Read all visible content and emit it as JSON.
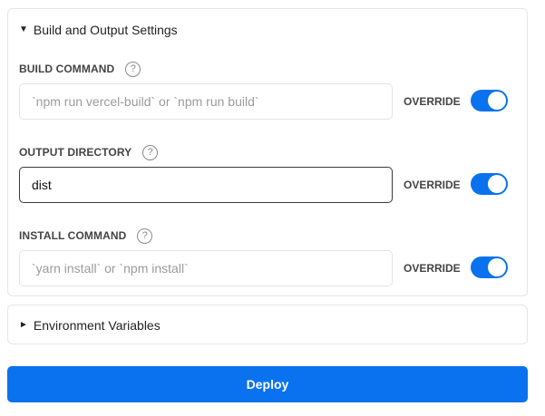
{
  "build_output": {
    "title": "Build and Output Settings",
    "expand_glyph": "▼",
    "fields": [
      {
        "label": "BUILD COMMAND",
        "help_glyph": "?",
        "value": "",
        "placeholder": "`npm run vercel-build` or `npm run build`",
        "override_label": "OVERRIDE",
        "override_on": true
      },
      {
        "label": "OUTPUT DIRECTORY",
        "help_glyph": "?",
        "value": "dist",
        "placeholder": "",
        "override_label": "OVERRIDE",
        "override_on": true
      },
      {
        "label": "INSTALL COMMAND",
        "help_glyph": "?",
        "value": "",
        "placeholder": "`yarn install` or `npm install`",
        "override_label": "OVERRIDE",
        "override_on": true
      }
    ]
  },
  "env_vars": {
    "title": "Environment Variables",
    "collapse_glyph": "►"
  },
  "deploy": {
    "label": "Deploy"
  },
  "colors": {
    "accent": "#0a72ef"
  }
}
